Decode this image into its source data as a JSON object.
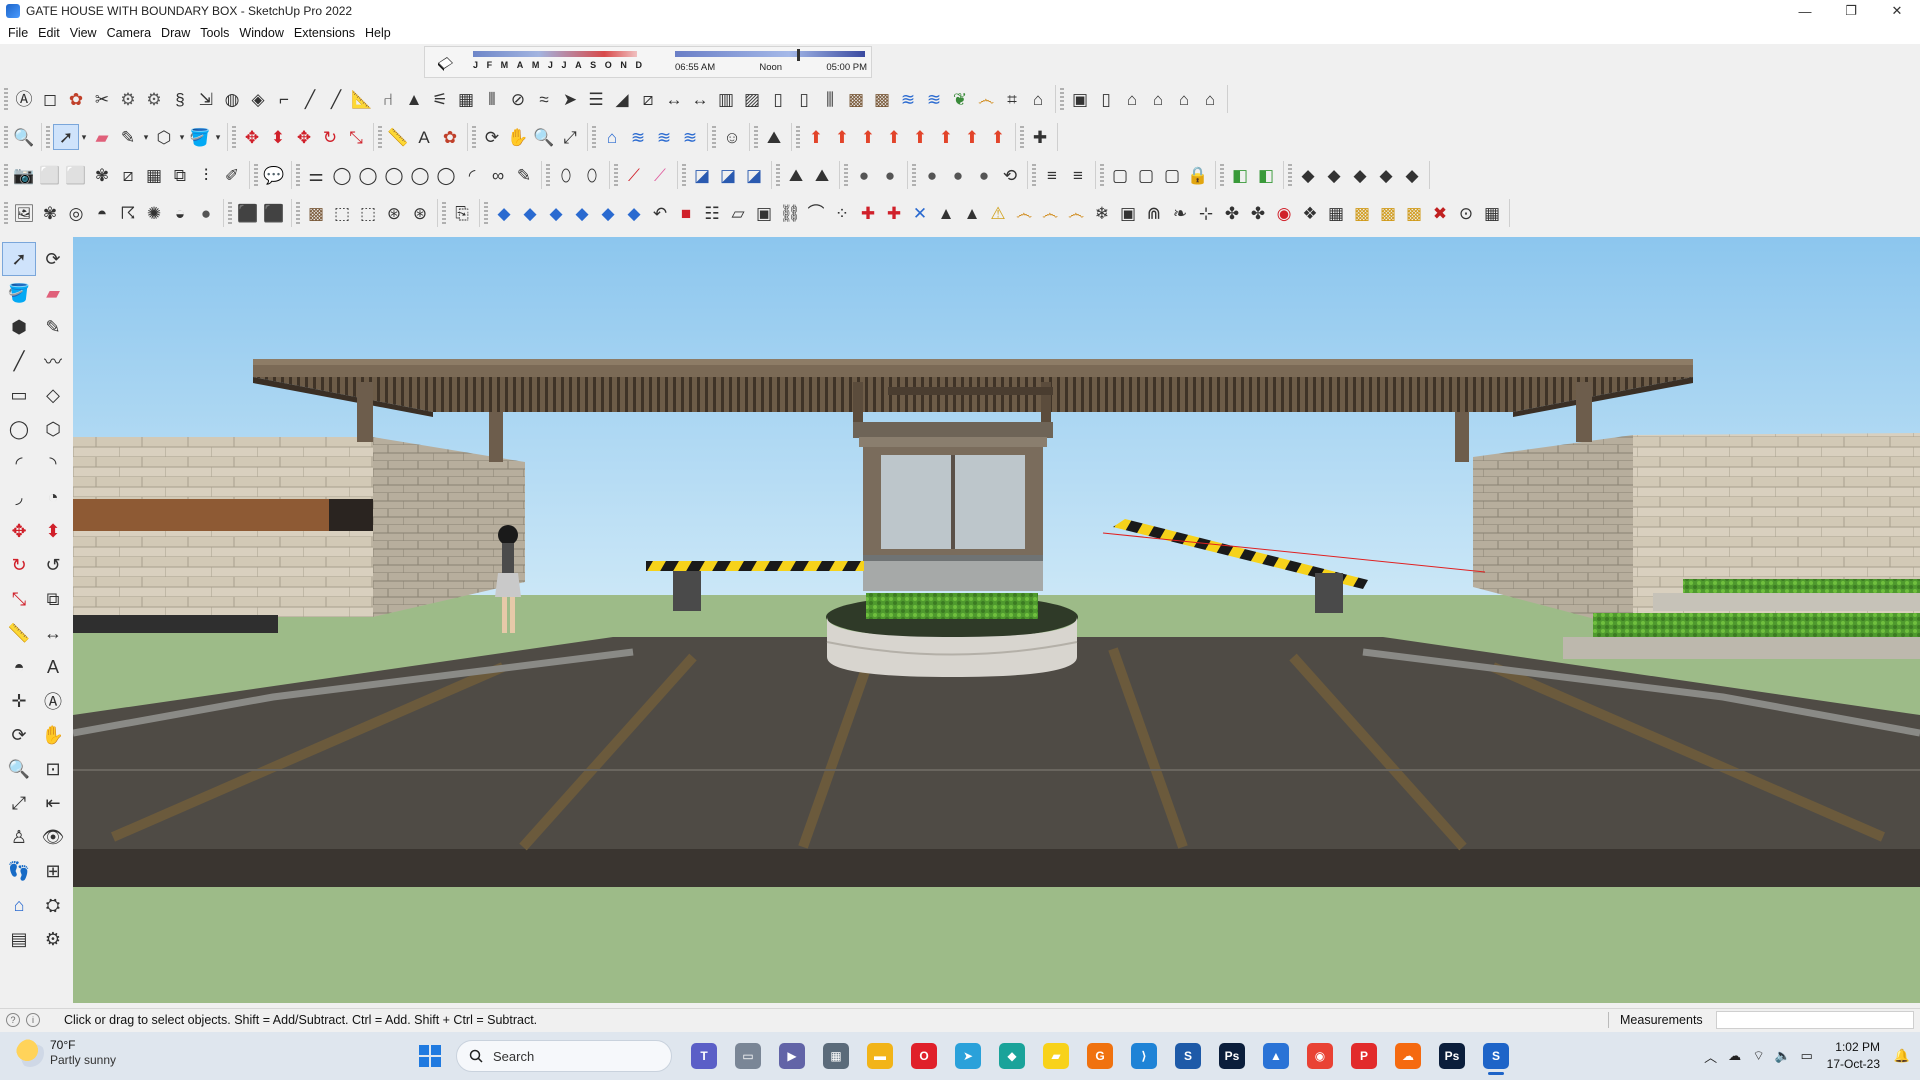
{
  "window": {
    "title": "GATE HOUSE WITH BOUNDARY BOX - SketchUp Pro 2022",
    "controls": [
      "minimize",
      "maximize",
      "close"
    ]
  },
  "menu": [
    "File",
    "Edit",
    "View",
    "Camera",
    "Draw",
    "Tools",
    "Window",
    "Extensions",
    "Help"
  ],
  "shadows": {
    "months": [
      "J",
      "F",
      "M",
      "A",
      "M",
      "J",
      "J",
      "A",
      "S",
      "O",
      "N",
      "D"
    ],
    "time_start": "06:55 AM",
    "time_mid": "Noon",
    "time_end": "05:00 PM"
  },
  "toolbars": {
    "row1": [
      [
        "3d-text-icon",
        "arc-tool-icon",
        "paint-icon",
        "scissors-icon",
        "gear-icon",
        "gear-icon",
        "spring-icon",
        "push-icon",
        "globe-icon",
        "shape-icon",
        "corner-icon",
        "line-icon",
        "line-icon",
        "ruler-icon",
        "chair-icon",
        "cone-icon",
        "stairs-icon",
        "grid-icon",
        "fence-icon",
        "pipe-icon",
        "wave-icon",
        "arrow-icon",
        "stack-icon",
        "slope-icon",
        "slice-icon",
        "dimension-icon",
        "dimension-icon",
        "column-icon",
        "hatch-icon",
        "door-icon",
        "door-icon",
        "railing-icon",
        "texture-icon",
        "texture-icon",
        "layers-icon",
        "layers-icon",
        "leaf-icon",
        "spiral-icon",
        "grate-icon",
        "shed-icon"
      ],
      [
        "box-icon",
        "door-icon",
        "house-icon",
        "house-icon",
        "house-icon",
        "house-icon"
      ]
    ],
    "row2": [
      [
        "zoom-icon"
      ],
      [
        "select-icon",
        "eraser-icon",
        "pencil-icon",
        "polygon-icon",
        "paint-bucket-icon"
      ],
      [
        "move-icon",
        "push-pull-icon",
        "move-icon",
        "rotate-icon",
        "scale-icon"
      ],
      [
        "tape-measure-icon",
        "text-icon",
        "paint-icon"
      ],
      [
        "orbit-icon",
        "pan-icon",
        "zoom-icon",
        "zoom-extents-icon"
      ],
      [
        "warehouse-icon",
        "layers-icon",
        "layers-icon",
        "layers-icon"
      ],
      [
        "person-icon"
      ],
      [
        "sandbox-icon"
      ],
      [
        "house-color-icon",
        "house-color-icon",
        "house-color-icon",
        "house-color-icon",
        "house-color-icon",
        "house-color-icon",
        "house-color-icon",
        "house-color-icon"
      ],
      [
        "extension-icon"
      ]
    ],
    "row3": [
      [
        "camera-icon",
        "cube-icon",
        "cube-icon",
        "plant-icon",
        "slice-icon",
        "grid-icon",
        "copy-icon",
        "tree-icon",
        "edit-icon"
      ],
      [
        "bubble-icon"
      ],
      [
        "measure-icon",
        "circle-icon",
        "circle-icon",
        "circle-icon",
        "circle-icon",
        "circle-icon",
        "arc-icon",
        "loop-icon",
        "pencil-icon"
      ],
      [
        "tag-icon",
        "tag-icon"
      ],
      [
        "line-red-icon",
        "line-pink-icon"
      ],
      [
        "section-icon",
        "section-icon",
        "section-icon"
      ],
      [
        "terrain-icon",
        "terrain-icon"
      ],
      [
        "sphere-icon",
        "sphere-icon"
      ],
      [
        "sphere-icon",
        "sphere-icon",
        "sphere-icon",
        "refresh-icon"
      ],
      [
        "layer-icon",
        "layer-icon"
      ],
      [
        "frame-icon",
        "frame-icon",
        "frame-icon",
        "lock-icon"
      ],
      [
        "material-icon",
        "material-icon"
      ],
      [
        "block-icon",
        "block-icon",
        "block-icon",
        "block-icon",
        "block-icon"
      ]
    ],
    "row4": [
      [
        "photo-icon",
        "plant-icon",
        "target-icon",
        "protractor-icon",
        "light-icon",
        "sun-icon",
        "sunset-icon",
        "sphere-icon"
      ],
      [
        "solid-icon",
        "solid-icon"
      ],
      [
        "texture-icon",
        "cube-outline-icon",
        "cube-outline-icon",
        "grid-sphere-icon",
        "grid-sphere-icon"
      ],
      [
        "cursor-copy-icon"
      ],
      [
        "plane-icon",
        "plane-icon",
        "plane-icon",
        "plane-icon",
        "plane-icon",
        "plane-icon",
        "turn-icon",
        "cube-red-icon",
        "list-icon",
        "page-icon",
        "box-icon",
        "link-icon",
        "curve-icon",
        "dots-icon",
        "cross-icon",
        "cross-icon",
        "tool-icon",
        "cone-icon",
        "cone-icon",
        "warning-icon",
        "spiral-icon",
        "spiral-icon",
        "spiral-icon",
        "snowflake-icon",
        "box-icon",
        "magnet-icon",
        "vine-icon",
        "dim-icon",
        "cluster-icon",
        "cluster-icon",
        "red-dot-icon",
        "ornament-icon",
        "window-icon",
        "panel-icon",
        "panel-icon",
        "panel-icon",
        "close-x-icon",
        "circle-dots-icon",
        "grid-box-icon"
      ]
    ],
    "left": [
      "select-icon",
      "orbit-icon",
      "paint-bucket-icon",
      "eraser-icon",
      "component-icon",
      "pencil-icon",
      "line-icon",
      "freehand-icon",
      "rectangle-icon",
      "rotated-rect-icon",
      "circle-icon",
      "polygon-icon",
      "arc-icon",
      "arc-2pt-icon",
      "arc-3pt-icon",
      "pie-icon",
      "move-icon",
      "push-pull-icon",
      "rotate-icon",
      "follow-me-icon",
      "scale-icon",
      "offset-icon",
      "tape-measure-icon",
      "dimension-icon",
      "protractor-icon",
      "text-icon",
      "axes-icon",
      "3d-text-icon",
      "orbit-icon",
      "pan-icon",
      "zoom-icon",
      "zoom-window-icon",
      "zoom-extents-icon",
      "previous-view-icon",
      "position-camera-icon",
      "look-around-icon",
      "walk-icon",
      "section-plane-icon",
      "warehouse-icon",
      "extension-warehouse-icon",
      "layout-icon",
      "extension-manager-icon"
    ]
  },
  "status": {
    "hint": "Click or drag to select objects. Shift = Add/Subtract. Ctrl = Add. Shift + Ctrl = Subtract.",
    "measurements_label": "Measurements",
    "measurements_value": ""
  },
  "taskbar": {
    "weather_temp": "70°F",
    "weather_desc": "Partly sunny",
    "search_label": "Search",
    "apps": [
      {
        "name": "teams",
        "color": "#5b5fc7",
        "glyph": "T"
      },
      {
        "name": "task-view",
        "color": "#7a8696",
        "glyph": "▭"
      },
      {
        "name": "meet",
        "color": "#6264a7",
        "glyph": "▶"
      },
      {
        "name": "calculator",
        "color": "#5b6b7a",
        "glyph": "▦"
      },
      {
        "name": "file-explorer",
        "color": "#f2b418",
        "glyph": "▬"
      },
      {
        "name": "opera",
        "color": "#e0202a",
        "glyph": "O"
      },
      {
        "name": "telegram",
        "color": "#2aa1da",
        "glyph": "➤"
      },
      {
        "name": "3d-app",
        "color": "#1aa39a",
        "glyph": "◆"
      },
      {
        "name": "sticky-notes",
        "color": "#f8d21a",
        "glyph": "▰"
      },
      {
        "name": "grammarly",
        "color": "#f0720f",
        "glyph": "G"
      },
      {
        "name": "vscode",
        "color": "#1f83d6",
        "glyph": "⟩"
      },
      {
        "name": "sketchup-2",
        "color": "#1e5aa8",
        "glyph": "S"
      },
      {
        "name": "photoshop",
        "color": "#0b1e3b",
        "glyph": "Ps"
      },
      {
        "name": "drive",
        "color": "#2a73d6",
        "glyph": "▲"
      },
      {
        "name": "chrome",
        "color": "#e94234",
        "glyph": "◉"
      },
      {
        "name": "pinterest",
        "color": "#e22b2b",
        "glyph": "P"
      },
      {
        "name": "soundcloud",
        "color": "#f56a10",
        "glyph": "☁"
      },
      {
        "name": "photoshop-2",
        "color": "#0b1e3b",
        "glyph": "Ps"
      },
      {
        "name": "sketchup",
        "color": "#1e64c8",
        "glyph": "S",
        "active": true
      }
    ],
    "time": "1:02 PM",
    "date": "17-Oct-23"
  },
  "colors": {
    "sky_top": "#8cc6ee",
    "sky_bottom": "#c9e6f7",
    "grass": "#9dbb88",
    "road": "#4f4b45",
    "stone": "#d9d0bf",
    "roof": "#5a4b3b",
    "barrier_yellow": "#f6d21a",
    "barrier_black": "#1a1a1a",
    "accent_select": "#cfe3fb"
  }
}
